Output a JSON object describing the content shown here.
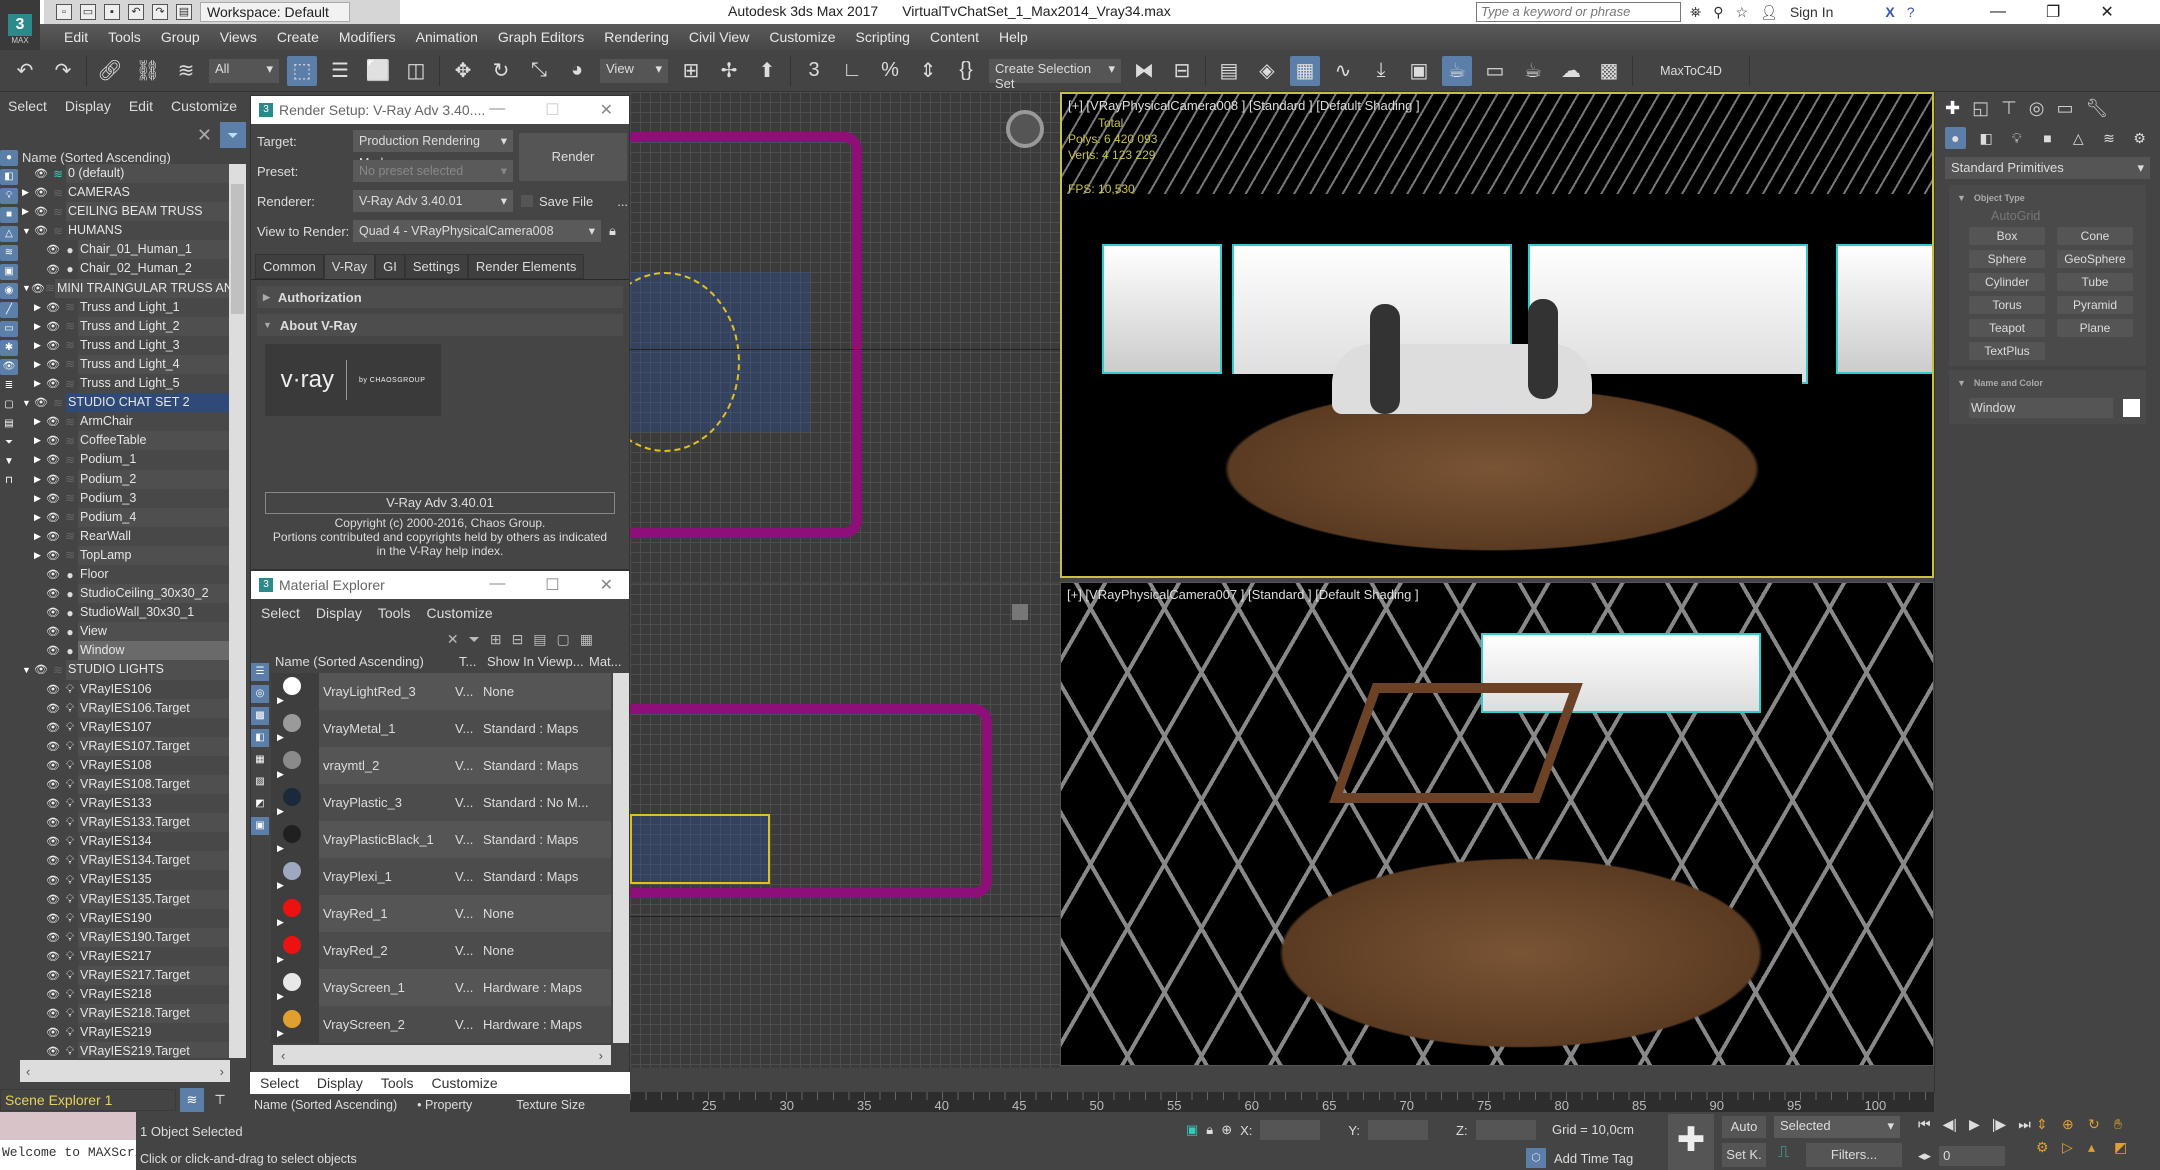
{
  "window": {
    "app_name": "Autodesk 3ds Max 2017",
    "file_name": "VirtualTvChatSet_1_Max2014_Vray34.max",
    "workspace": "Workspace: Default",
    "search_placeholder": "Type a keyword or phrase",
    "sign_in": "Sign In",
    "logo_badge": "3",
    "logo_sub": "MAX"
  },
  "menu": [
    "Edit",
    "Tools",
    "Group",
    "Views",
    "Create",
    "Modifiers",
    "Animation",
    "Graph Editors",
    "Rendering",
    "Civil View",
    "Customize",
    "Scripting",
    "Content",
    "Help"
  ],
  "toolbar": {
    "filter_dropdown": "All",
    "ref_coord_dropdown": "View",
    "selection_set": "Create Selection Set",
    "plugin_label": "MaxToC4D"
  },
  "scene_explorer": {
    "menu": [
      "Select",
      "Display",
      "Edit",
      "Customize"
    ],
    "column_header": "Name (Sorted Ascending)",
    "footer_name": "Scene Explorer 1",
    "rows": [
      {
        "label": "0 (default)",
        "level": 0,
        "type": "layer-active",
        "expand": ""
      },
      {
        "label": "CAMERAS",
        "level": 0,
        "type": "layer",
        "expand": "▶"
      },
      {
        "label": "CEILING BEAM TRUSS",
        "level": 0,
        "type": "layer",
        "expand": "▶"
      },
      {
        "label": "HUMANS",
        "level": 0,
        "type": "layer",
        "expand": "▼"
      },
      {
        "label": "Chair_01_Human_1",
        "level": 1,
        "type": "object",
        "expand": ""
      },
      {
        "label": "Chair_02_Human_2",
        "level": 1,
        "type": "object",
        "expand": ""
      },
      {
        "label": "MINI TRAINGULAR TRUSS AND",
        "level": 0,
        "type": "layer",
        "expand": "▼"
      },
      {
        "label": "Truss and Light_1",
        "level": 1,
        "type": "layer",
        "expand": "▶"
      },
      {
        "label": "Truss and Light_2",
        "level": 1,
        "type": "layer",
        "expand": "▶"
      },
      {
        "label": "Truss and Light_3",
        "level": 1,
        "type": "layer",
        "expand": "▶"
      },
      {
        "label": "Truss and Light_4",
        "level": 1,
        "type": "layer",
        "expand": "▶"
      },
      {
        "label": "Truss and Light_5",
        "level": 1,
        "type": "layer",
        "expand": "▶"
      },
      {
        "label": "STUDIO CHAT SET 2",
        "level": 0,
        "type": "layer",
        "expand": "▼",
        "selected": true
      },
      {
        "label": "ArmChair",
        "level": 1,
        "type": "layer",
        "expand": "▶"
      },
      {
        "label": "CoffeeTable",
        "level": 1,
        "type": "layer",
        "expand": "▶"
      },
      {
        "label": "Podium_1",
        "level": 1,
        "type": "layer",
        "expand": "▶"
      },
      {
        "label": "Podium_2",
        "level": 1,
        "type": "layer",
        "expand": "▶"
      },
      {
        "label": "Podium_3",
        "level": 1,
        "type": "layer",
        "expand": "▶"
      },
      {
        "label": "Podium_4",
        "level": 1,
        "type": "layer",
        "expand": "▶"
      },
      {
        "label": "RearWall",
        "level": 1,
        "type": "layer",
        "expand": "▶"
      },
      {
        "label": "TopLamp",
        "level": 1,
        "type": "layer",
        "expand": "▶"
      },
      {
        "label": "Floor",
        "level": 1,
        "type": "object",
        "expand": ""
      },
      {
        "label": "StudioCeiling_30x30_2",
        "level": 1,
        "type": "object",
        "expand": ""
      },
      {
        "label": "StudioWall_30x30_1",
        "level": 1,
        "type": "object",
        "expand": ""
      },
      {
        "label": "View",
        "level": 1,
        "type": "object",
        "expand": ""
      },
      {
        "label": "Window",
        "level": 1,
        "type": "object",
        "expand": "",
        "highlighted": true
      },
      {
        "label": "STUDIO LIGHTS",
        "level": 0,
        "type": "layer",
        "expand": "▼"
      },
      {
        "label": "VRayIES106",
        "level": 1,
        "type": "light",
        "expand": ""
      },
      {
        "label": "VRayIES106.Target",
        "level": 1,
        "type": "light",
        "expand": ""
      },
      {
        "label": "VRayIES107",
        "level": 1,
        "type": "light",
        "expand": ""
      },
      {
        "label": "VRayIES107.Target",
        "level": 1,
        "type": "light",
        "expand": ""
      },
      {
        "label": "VRayIES108",
        "level": 1,
        "type": "light",
        "expand": ""
      },
      {
        "label": "VRayIES108.Target",
        "level": 1,
        "type": "light",
        "expand": ""
      },
      {
        "label": "VRayIES133",
        "level": 1,
        "type": "light",
        "expand": ""
      },
      {
        "label": "VRayIES133.Target",
        "level": 1,
        "type": "light",
        "expand": ""
      },
      {
        "label": "VRayIES134",
        "level": 1,
        "type": "light",
        "expand": ""
      },
      {
        "label": "VRayIES134.Target",
        "level": 1,
        "type": "light",
        "expand": ""
      },
      {
        "label": "VRayIES135",
        "level": 1,
        "type": "light",
        "expand": ""
      },
      {
        "label": "VRayIES135.Target",
        "level": 1,
        "type": "light",
        "expand": ""
      },
      {
        "label": "VRayIES190",
        "level": 1,
        "type": "light",
        "expand": ""
      },
      {
        "label": "VRayIES190.Target",
        "level": 1,
        "type": "light",
        "expand": ""
      },
      {
        "label": "VRayIES217",
        "level": 1,
        "type": "light",
        "expand": ""
      },
      {
        "label": "VRayIES217.Target",
        "level": 1,
        "type": "light",
        "expand": ""
      },
      {
        "label": "VRayIES218",
        "level": 1,
        "type": "light",
        "expand": ""
      },
      {
        "label": "VRayIES218.Target",
        "level": 1,
        "type": "light",
        "expand": ""
      },
      {
        "label": "VRayIES219",
        "level": 1,
        "type": "light",
        "expand": ""
      },
      {
        "label": "VRayIES219.Target",
        "level": 1,
        "type": "light",
        "expand": ""
      }
    ]
  },
  "render_setup": {
    "title": "Render Setup: V-Ray Adv 3.40....",
    "target_label": "Target:",
    "target_value": "Production Rendering Mode",
    "preset_label": "Preset:",
    "preset_value": "No preset selected",
    "renderer_label": "Renderer:",
    "renderer_value": "V-Ray Adv 3.40.01",
    "save_file": "Save File",
    "more": "...",
    "view_label": "View to Render:",
    "view_value": "Quad 4 - VRayPhysicalCamera008",
    "render_button": "Render",
    "tabs": [
      "Common",
      "V-Ray",
      "GI",
      "Settings",
      "Render Elements"
    ],
    "active_tab": "V-Ray",
    "rollouts": {
      "authorization": "Authorization",
      "about": "About V-Ray"
    },
    "logo_text": "v·ray",
    "logo_by": "by CHAOSGROUP",
    "version_box": "V-Ray Adv 3.40.01",
    "copyright_1": "Copyright (c) 2000-2016, Chaos Group.",
    "copyright_2": "Portions contributed and copyrights held by others as indicated",
    "copyright_3": "in the V-Ray help index."
  },
  "material_explorer": {
    "title": "Material Explorer",
    "menu": [
      "Select",
      "Display",
      "Tools",
      "Customize"
    ],
    "columns": [
      "Name (Sorted Ascending)",
      "T...",
      "Show In Viewp...",
      "Mat..."
    ],
    "rows": [
      {
        "name": "VrayLightRed_3",
        "type": "V...",
        "show": "None",
        "swatch": "#ffffff"
      },
      {
        "name": "VrayMetal_1",
        "type": "V...",
        "show": "Standard : Maps",
        "swatch": "#9a9a9a"
      },
      {
        "name": "vraymtl_2",
        "type": "V...",
        "show": "Standard : Maps",
        "swatch": "#8a8a8a"
      },
      {
        "name": "VrayPlastic_3",
        "type": "V...",
        "show": "Standard : No M...",
        "swatch": "#1a2a3a"
      },
      {
        "name": "VrayPlasticBlack_1",
        "type": "V...",
        "show": "Standard : Maps",
        "swatch": "#202020"
      },
      {
        "name": "VrayPlexi_1",
        "type": "V...",
        "show": "Standard : Maps",
        "swatch": "#a0a8c0"
      },
      {
        "name": "VrayRed_1",
        "type": "V...",
        "show": "None",
        "swatch": "#ee1111"
      },
      {
        "name": "VrayRed_2",
        "type": "V...",
        "show": "None",
        "swatch": "#ee1111"
      },
      {
        "name": "VrayScreen_1",
        "type": "V...",
        "show": "Hardware : Maps",
        "swatch": "#e8e8e8"
      },
      {
        "name": "VrayScreen_2",
        "type": "V...",
        "show": "Hardware : Maps",
        "swatch": "#e0a030"
      }
    ],
    "second_menu": [
      "Select",
      "Display",
      "Tools",
      "Customize"
    ],
    "second_columns": [
      "Name (Sorted Ascending)",
      "• Property",
      "Texture Size"
    ]
  },
  "viewports": {
    "cam8_label": "[+] [VRayPhysicalCamera008 ] [Standard ] [Default Shading ]",
    "cam8_stats": {
      "total": "Total",
      "polys_label": "Polys:",
      "polys": "6 420 093",
      "verts_label": "Verts:",
      "verts": "4 123 229",
      "fps_label": "FPS:",
      "fps": "10,530"
    },
    "cam7_label": "[+] [VRayPhysicalCamera007 ] [Standard ] [Default Shading ]"
  },
  "command_panel": {
    "category_dropdown": "Standard Primitives",
    "object_type_title": "Object Type",
    "autogrid": "AutoGrid",
    "buttons": [
      "Box",
      "Cone",
      "Sphere",
      "GeoSphere",
      "Cylinder",
      "Tube",
      "Torus",
      "Pyramid",
      "Teapot",
      "Plane",
      "TextPlus"
    ],
    "name_color_title": "Name and Color",
    "name_value": "Window",
    "color": "#ffffff"
  },
  "timeline": {
    "ticks": [
      "25",
      "30",
      "35",
      "40",
      "45",
      "50",
      "55",
      "60",
      "65",
      "70",
      "75",
      "80",
      "85",
      "90",
      "95",
      "100"
    ]
  },
  "status": {
    "maxscript": "Welcome to MAXScript.",
    "selection": "1 Object Selected",
    "prompt": "Click or click-and-drag to select objects",
    "x_label": "X:",
    "y_label": "Y:",
    "z_label": "Z:",
    "grid": "Grid = 10,0cm",
    "add_time_tag": "Add Time Tag",
    "auto": "Auto",
    "set_key": "Set K.",
    "key_filter": "Selected",
    "filters": "Filters...",
    "frame": "0"
  },
  "colors": {
    "accent": "#5b7fa8",
    "selection_frame": "#c8c040",
    "layout_pink": "#8e0f78",
    "statusbar_label": "#e6d35a"
  }
}
